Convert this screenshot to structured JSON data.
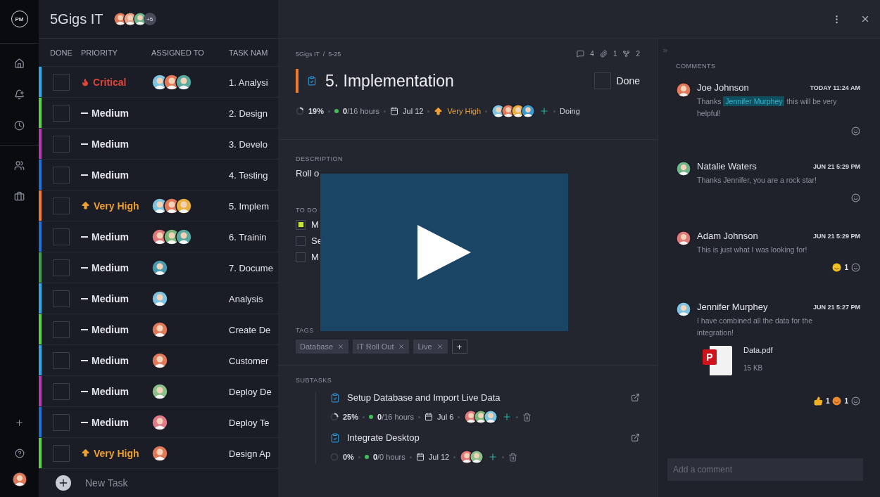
{
  "rail": {
    "logo": "PM"
  },
  "project": {
    "title": "5Gigs IT",
    "members": [
      {
        "color": "#e0795a"
      },
      {
        "color": "#e8a08a"
      },
      {
        "color": "#6fb58a"
      }
    ],
    "more": "+5"
  },
  "table": {
    "columns": [
      "DONE",
      "PRIORITY",
      "ASSIGNED TO",
      "TASK NAM"
    ],
    "rows": [
      {
        "color": "#2fa8e6",
        "done": false,
        "priority": {
          "kind": "critical",
          "label": "Critical"
        },
        "assignees": [
          {
            "color": "#7ec3e0"
          },
          {
            "color": "#e0795a"
          },
          {
            "color": "#5aa9a0"
          }
        ],
        "task": "1. Analysi"
      },
      {
        "color": "#5fd04a",
        "done": false,
        "priority": {
          "kind": "medium",
          "label": "Medium"
        },
        "task": "2. Design"
      },
      {
        "color": "#b23cb0",
        "done": false,
        "priority": {
          "kind": "medium",
          "label": "Medium"
        },
        "task": "3. Develo"
      },
      {
        "color": "#1f6fd0",
        "done": false,
        "priority": {
          "kind": "medium",
          "label": "Medium"
        },
        "task": "4. Testing"
      },
      {
        "color": "#f07a2a",
        "done": false,
        "priority": {
          "kind": "very_high",
          "label": "Very High"
        },
        "assignees": [
          {
            "color": "#7ec3e0"
          },
          {
            "color": "#e0795a"
          },
          {
            "color": "#e8b040"
          }
        ],
        "task": "5. Implem"
      },
      {
        "color": "#1f6fd0",
        "done": false,
        "priority": {
          "kind": "medium",
          "label": "Medium"
        },
        "assignees": [
          {
            "color": "#e07a7a"
          },
          {
            "color": "#7ab87a"
          },
          {
            "color": "#5aa9a0"
          }
        ],
        "task": "6. Trainin"
      },
      {
        "color": "#3fa050",
        "done": false,
        "priority": {
          "kind": "medium",
          "label": "Medium"
        },
        "assignees": [
          {
            "color": "#4a9ab0"
          }
        ],
        "task": "7. Docume"
      },
      {
        "color": "#2fa8e6",
        "done": false,
        "priority": {
          "kind": "medium",
          "label": "Medium"
        },
        "assignees": [
          {
            "color": "#7ec3e0"
          }
        ],
        "task": "Analysis"
      },
      {
        "color": "#5fd04a",
        "done": false,
        "priority": {
          "kind": "medium",
          "label": "Medium"
        },
        "assignees": [
          {
            "color": "#e0795a"
          }
        ],
        "task": "Create De"
      },
      {
        "color": "#2fa8e6",
        "done": false,
        "priority": {
          "kind": "medium",
          "label": "Medium"
        },
        "assignees": [
          {
            "color": "#e0795a"
          }
        ],
        "task": "Customer"
      },
      {
        "color": "#b23cb0",
        "done": false,
        "priority": {
          "kind": "medium",
          "label": "Medium"
        },
        "assignees": [
          {
            "color": "#8cc08a"
          }
        ],
        "task": "Deploy De"
      },
      {
        "color": "#1f6fd0",
        "done": false,
        "priority": {
          "kind": "medium",
          "label": "Medium"
        },
        "assignees": [
          {
            "color": "#e07a8a"
          }
        ],
        "task": "Deploy Te"
      },
      {
        "color": "#5fd04a",
        "done": false,
        "priority": {
          "kind": "very_high",
          "label": "Very High"
        },
        "assignees": [
          {
            "color": "#e0795a"
          }
        ],
        "task": "Design Ap"
      }
    ],
    "new_task": "New Task"
  },
  "detail": {
    "breadcrumb": "5Gigs IT  /  5-25",
    "counts": {
      "comments": "4",
      "attachments": "1",
      "subtasks": "2"
    },
    "title": "5. Implementation",
    "done": {
      "label": "Done",
      "checked": false
    },
    "meta": {
      "level": 0.19,
      "progress": "19%",
      "hours": "**0**/16 hours",
      "date": "Jul 12",
      "priority": {
        "kind": "very_high",
        "label": "Very High"
      },
      "assignees": [
        {
          "color": "#7ec3e0"
        },
        {
          "color": "#e0795a"
        },
        {
          "color": "#e8b040"
        },
        {
          "color": "#3a9ad0"
        }
      ],
      "status": "Doing"
    },
    "description": {
      "label": "DESCRIPTION",
      "text": "Roll o"
    },
    "todo": {
      "label": "TO DO",
      "items": [
        {
          "text": "M",
          "checked": true
        },
        {
          "text": "Se",
          "checked": false
        },
        {
          "text": "M",
          "checked": false
        }
      ]
    },
    "tags": {
      "label": "TAGS",
      "items": [
        "Database",
        "IT Roll Out",
        "Live"
      ],
      "add": "+"
    },
    "subtasks": {
      "label": "SUBTASKS",
      "items": [
        {
          "name": "Setup Database and Import Live Data",
          "level": 0.25,
          "progress": "25%",
          "hours": "**0**/16 hours",
          "date": "Jul 6",
          "assignees": [
            {
              "color": "#e07a7a"
            },
            {
              "color": "#7ab87a"
            },
            {
              "color": "#7ec3e0"
            }
          ]
        },
        {
          "name": "Integrate Desktop",
          "level": 0,
          "progress": "0%",
          "hours": "**0**/0 hours",
          "date": "Jul 12",
          "assignees": [
            {
              "color": "#e07a7a"
            },
            {
              "color": "#8cc08a"
            }
          ]
        }
      ]
    }
  },
  "video_overlay": {
    "shown": true
  },
  "comments": {
    "label": "COMMENTS",
    "items": [
      {
        "author": "Joe Johnson",
        "time": "TODAY 11:24 AM",
        "avatar": {
          "color": "#e0795a"
        },
        "text": "Thanks ",
        "mention": "Jennifer Murphey",
        "text_after": " this will be very helpful!"
      },
      {
        "author": "Natalie Waters",
        "time": "JUN 21 5:29 PM",
        "avatar": {
          "color": "#6fb58a"
        },
        "text": "Thanks Jennifer, you are a rock star!"
      },
      {
        "author": "Adam Johnson",
        "time": "JUN 21 5:29 PM",
        "avatar": {
          "color": "#e07a7a"
        },
        "text": "This is just what I was looking for!",
        "reactions": [
          {
            "kind": "smile",
            "count": "1"
          }
        ]
      },
      {
        "author": "Jennifer Murphey",
        "time": "JUN 21 5:27 PM",
        "avatar": {
          "color": "#7ec3e0"
        },
        "text": "I have combined all the data for the integration!",
        "attachment": {
          "name": "Data.pdf",
          "size": "15 KB",
          "badge": "P"
        },
        "reactions": [
          {
            "kind": "thumbs",
            "count": "1"
          },
          {
            "kind": "love",
            "count": "1"
          }
        ]
      }
    ],
    "input": {
      "placeholder": "Add a comment"
    }
  }
}
